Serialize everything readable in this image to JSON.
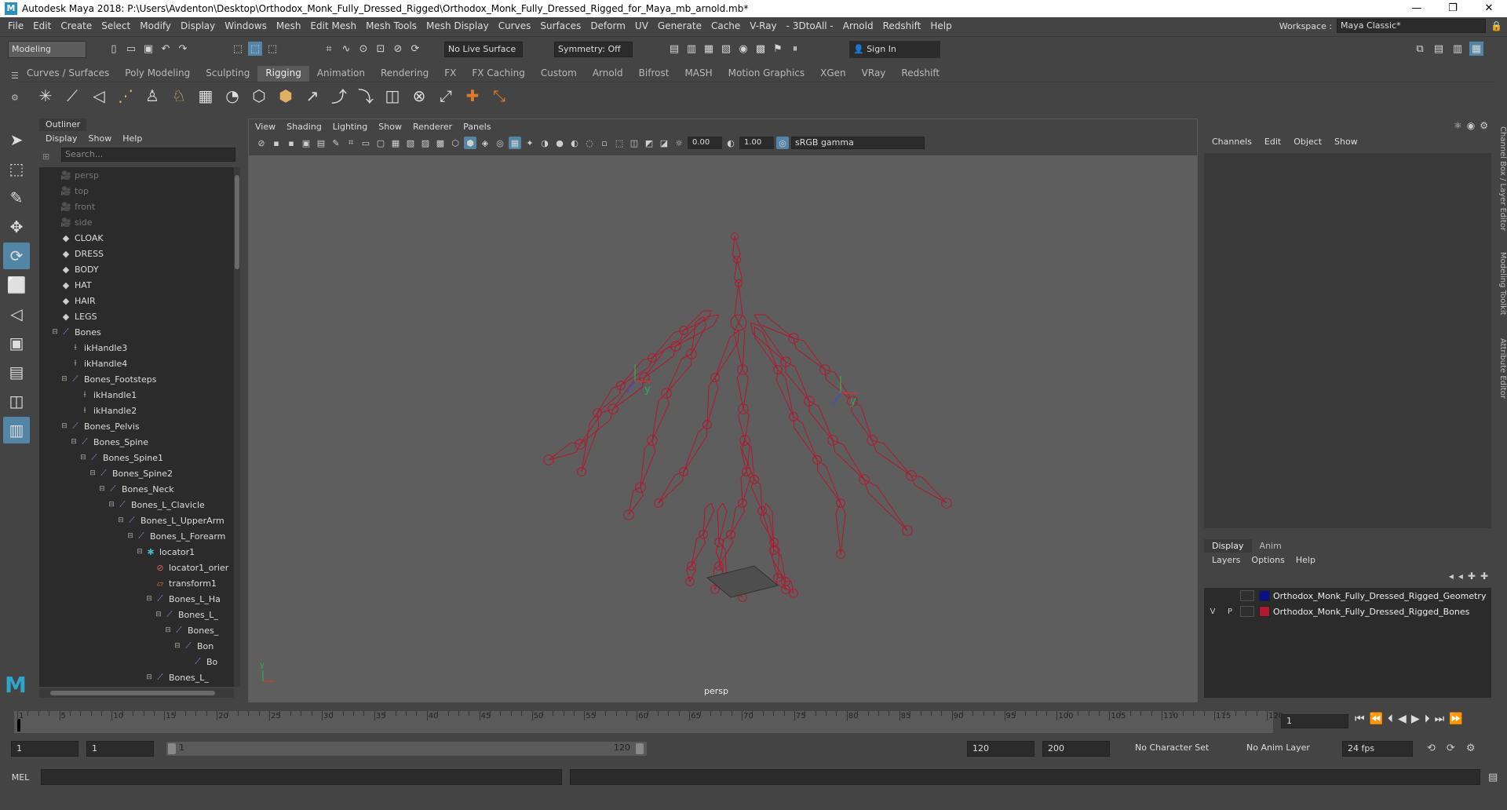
{
  "window": {
    "title": "Autodesk Maya 2018: P:\\Users\\Avdenton\\Desktop\\Orthodox_Monk_Fully_Dressed_Rigged\\Orthodox_Monk_Fully_Dressed_Rigged_for_Maya_mb_arnold.mb*",
    "controls": [
      "—",
      "❐",
      "✕"
    ]
  },
  "menubar": {
    "items": [
      "File",
      "Edit",
      "Create",
      "Select",
      "Modify",
      "Display",
      "Windows",
      "Mesh",
      "Edit Mesh",
      "Mesh Tools",
      "Mesh Display",
      "Curves",
      "Surfaces",
      "Deform",
      "UV",
      "Generate",
      "Cache",
      "V-Ray",
      "- 3DtoAll -",
      "Arnold",
      "Redshift",
      "Help"
    ],
    "workspace_label": "Workspace :",
    "workspace_value": "Maya Classic*"
  },
  "statusline": {
    "mode": "Modeling",
    "live_surface": "No Live Surface",
    "symmetry": "Symmetry: Off",
    "sign_in": "Sign In"
  },
  "shelf": {
    "tabs": [
      "Curves / Surfaces",
      "Poly Modeling",
      "Sculpting",
      "Rigging",
      "Animation",
      "Rendering",
      "FX",
      "FX Caching",
      "Custom",
      "Arnold",
      "Bifrost",
      "MASH",
      "Motion Graphics",
      "XGen",
      "VRay",
      "Redshift"
    ],
    "active_tab": "Rigging",
    "icons": [
      "✳",
      "⟋",
      "◁",
      "⋰",
      "♙",
      "♘",
      "▦",
      "◔",
      "⬡",
      "⬢",
      "↗",
      "⤴",
      "⤵",
      "◫",
      "⊗",
      "⤢",
      "✚",
      "⤡"
    ]
  },
  "toolbox": {
    "tools": [
      "➤",
      "⬚",
      "✎",
      "✥",
      "⟳",
      "⬜",
      "◁",
      "▣",
      "▤",
      "◫",
      "▥"
    ]
  },
  "outliner": {
    "tab": "Outliner",
    "menu": [
      "Display",
      "Show",
      "Help"
    ],
    "search_placeholder": "Search...",
    "rows": [
      {
        "label": "persp",
        "icon": "🎥",
        "indent": 0,
        "exp": "",
        "dim": true
      },
      {
        "label": "top",
        "icon": "🎥",
        "indent": 0,
        "exp": "",
        "dim": true
      },
      {
        "label": "front",
        "icon": "🎥",
        "indent": 0,
        "exp": "",
        "dim": true
      },
      {
        "label": "side",
        "icon": "🎥",
        "indent": 0,
        "exp": "",
        "dim": true
      },
      {
        "label": "CLOAK",
        "icon": "◆",
        "indent": 0,
        "exp": "",
        "dim": false
      },
      {
        "label": "DRESS",
        "icon": "◆",
        "indent": 0,
        "exp": "",
        "dim": false
      },
      {
        "label": "BODY",
        "icon": "◆",
        "indent": 0,
        "exp": "",
        "dim": false
      },
      {
        "label": "HAT",
        "icon": "◆",
        "indent": 0,
        "exp": "",
        "dim": false
      },
      {
        "label": "HAIR",
        "icon": "◆",
        "indent": 0,
        "exp": "",
        "dim": false
      },
      {
        "label": "LEGS",
        "icon": "◆",
        "indent": 0,
        "exp": "",
        "dim": false
      },
      {
        "label": "Bones",
        "icon": "⟋",
        "indent": 0,
        "exp": "⊟",
        "dim": false
      },
      {
        "label": "ikHandle3",
        "icon": "⟊",
        "indent": 1,
        "exp": "",
        "dim": false
      },
      {
        "label": "ikHandle4",
        "icon": "⟊",
        "indent": 1,
        "exp": "",
        "dim": false
      },
      {
        "label": "Bones_Footsteps",
        "icon": "⟋",
        "indent": 1,
        "exp": "⊟",
        "dim": false
      },
      {
        "label": "ikHandle1",
        "icon": "⟊",
        "indent": 2,
        "exp": "",
        "dim": false
      },
      {
        "label": "ikHandle2",
        "icon": "⟊",
        "indent": 2,
        "exp": "",
        "dim": false
      },
      {
        "label": "Bones_Pelvis",
        "icon": "⟋",
        "indent": 1,
        "exp": "⊟",
        "dim": false
      },
      {
        "label": "Bones_Spine",
        "icon": "⟋",
        "indent": 2,
        "exp": "⊟",
        "dim": false
      },
      {
        "label": "Bones_Spine1",
        "icon": "⟋",
        "indent": 3,
        "exp": "⊟",
        "dim": false
      },
      {
        "label": "Bones_Spine2",
        "icon": "⟋",
        "indent": 4,
        "exp": "⊟",
        "dim": false
      },
      {
        "label": "Bones_Neck",
        "icon": "⟋",
        "indent": 5,
        "exp": "⊟",
        "dim": false
      },
      {
        "label": "Bones_L_Clavicle",
        "icon": "⟋",
        "indent": 6,
        "exp": "⊟",
        "dim": false
      },
      {
        "label": "Bones_L_UpperArm",
        "icon": "⟋",
        "indent": 7,
        "exp": "⊟",
        "dim": false
      },
      {
        "label": "Bones_L_Forearm",
        "icon": "⟋",
        "indent": 8,
        "exp": "⊟",
        "dim": false
      },
      {
        "label": "locator1",
        "icon": "✱",
        "indent": 9,
        "exp": "⊟",
        "dim": false
      },
      {
        "label": "locator1_orier",
        "icon": "⊘",
        "indent": 10,
        "exp": "",
        "dim": false
      },
      {
        "label": "transform1",
        "icon": "▱",
        "indent": 10,
        "exp": "",
        "dim": false
      },
      {
        "label": "Bones_L_Ha",
        "icon": "⟋",
        "indent": 10,
        "exp": "⊟",
        "dim": false
      },
      {
        "label": "Bones_L_",
        "icon": "⟋",
        "indent": 11,
        "exp": "⊟",
        "dim": false
      },
      {
        "label": "Bones_",
        "icon": "⟋",
        "indent": 12,
        "exp": "⊟",
        "dim": false
      },
      {
        "label": "Bon",
        "icon": "⟋",
        "indent": 13,
        "exp": "⊟",
        "dim": false
      },
      {
        "label": "Bo",
        "icon": "⟋",
        "indent": 14,
        "exp": "",
        "dim": false
      },
      {
        "label": "Bones_L_",
        "icon": "⟋",
        "indent": 10,
        "exp": "⊟",
        "dim": false
      }
    ]
  },
  "viewport": {
    "menu": [
      "View",
      "Shading",
      "Lighting",
      "Show",
      "Renderer",
      "Panels"
    ],
    "field_a": "0.00",
    "field_b": "1.00",
    "colorspace": "sRGB gamma",
    "camera": "persp",
    "axis_labels": [
      "y",
      "x",
      "z"
    ]
  },
  "channelbox": {
    "menu": [
      "Channels",
      "Edit",
      "Object",
      "Show"
    ],
    "side_tabs": [
      "Channel Box / Layer Editor",
      "Modeling Toolkit",
      "Attribute Editor"
    ],
    "layer_tabs": [
      "Display",
      "Anim"
    ],
    "layer_menu": [
      "Layers",
      "Options",
      "Help"
    ],
    "layers": [
      {
        "v": "",
        "p": "",
        "name": "Orthodox_Monk_Fully_Dressed_Rigged_Geometry",
        "color": "#0b0f8a"
      },
      {
        "v": "V",
        "p": "P",
        "name": "Orthodox_Monk_Fully_Dressed_Rigged_Bones",
        "color": "#b3182f"
      }
    ]
  },
  "timeline": {
    "ticks": [
      "1",
      "5",
      "10",
      "15",
      "20",
      "25",
      "30",
      "35",
      "40",
      "45",
      "50",
      "55",
      "60",
      "65",
      "70",
      "75",
      "80",
      "85",
      "90",
      "95",
      "100",
      "105",
      "110",
      "115",
      "120"
    ],
    "current_frame": "1",
    "playback_icons": [
      "⏮",
      "⏪",
      "⏴",
      "◀",
      "▶",
      "⏵",
      "⏭",
      "⏩"
    ]
  },
  "range": {
    "start": "1",
    "playback_start": "1",
    "slider_start": "1",
    "slider_end": "120",
    "playback_end": "120",
    "end": "200",
    "character_set": "No Character Set",
    "anim_layer": "No Anim Layer",
    "fps": "24 fps"
  },
  "commandline": {
    "label": "MEL"
  },
  "colors": {
    "bones": "#b3182f",
    "accent": "#5285a6"
  }
}
